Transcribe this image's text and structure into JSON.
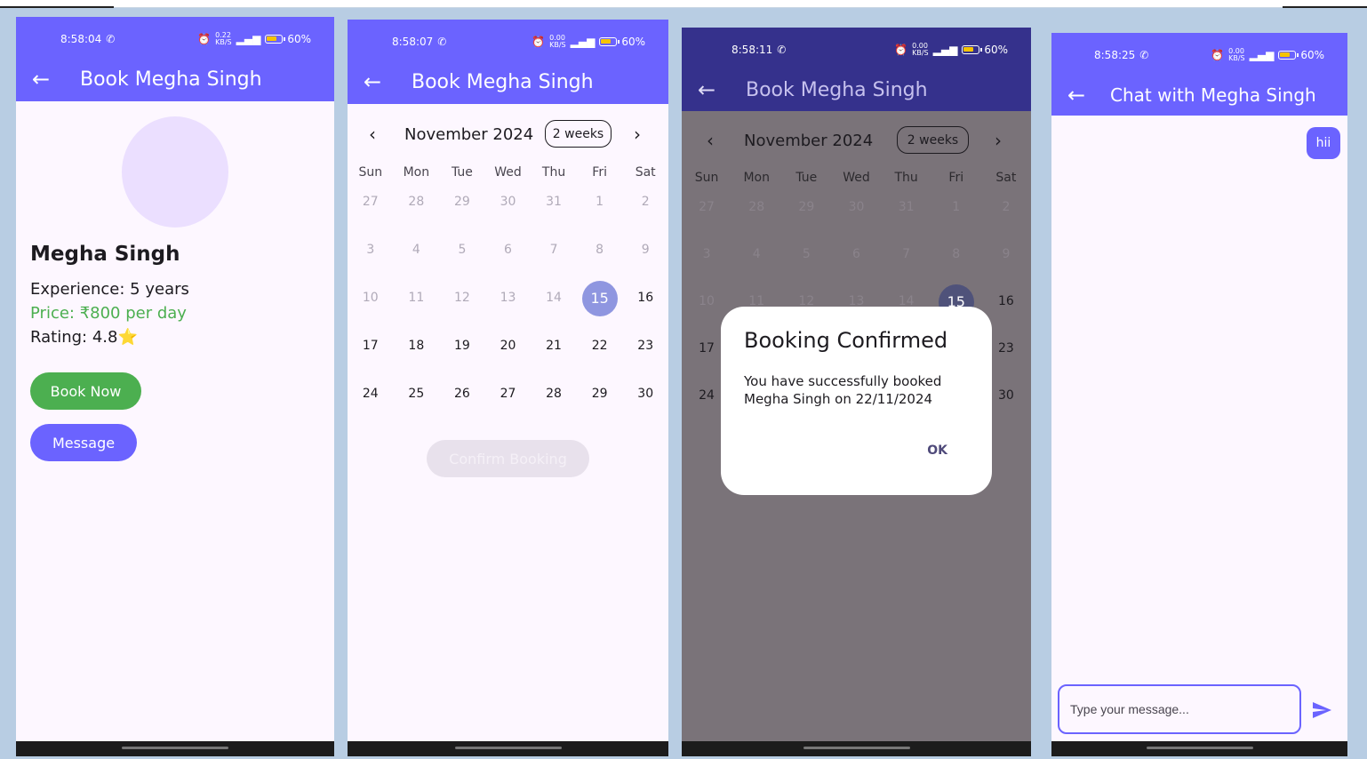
{
  "status": {
    "p1_time": "8:58:04",
    "p2_time": "8:58:07",
    "p3_time": "8:58:11",
    "p4_time": "8:58:25",
    "p1_speed": "0.22",
    "speed_other": "0.00",
    "speed_unit": "KB/S",
    "battery": "60%"
  },
  "colors": {
    "primary": "#6b63ff",
    "green": "#4caf50",
    "avatar": "#ebdfff"
  },
  "profile": {
    "title": "Book Megha Singh",
    "name": "Megha Singh",
    "experience": "Experience: 5 years",
    "price": "Price: ₹800 per day",
    "rating": "Rating: 4.8",
    "rating_star": "⭐",
    "book_now": "Book Now",
    "message": "Message"
  },
  "calendar": {
    "title": "Book Megha Singh",
    "month": "November 2024",
    "format": "2 weeks",
    "prev": "‹",
    "next": "›",
    "weekdays": [
      "Sun",
      "Mon",
      "Tue",
      "Wed",
      "Thu",
      "Fri",
      "Sat"
    ],
    "rows": [
      [
        "27",
        "28",
        "29",
        "30",
        "31",
        "1",
        "2"
      ],
      [
        "3",
        "4",
        "5",
        "6",
        "7",
        "8",
        "9"
      ],
      [
        "10",
        "11",
        "12",
        "13",
        "14",
        "15",
        "16"
      ],
      [
        "17",
        "18",
        "19",
        "20",
        "21",
        "22",
        "23"
      ],
      [
        "24",
        "25",
        "26",
        "27",
        "28",
        "29",
        "30"
      ]
    ],
    "selected": "15",
    "confirm": "Confirm Booking"
  },
  "dialog": {
    "title": "Booking Confirmed",
    "body": "You have successfully booked Megha Singh on 22/11/2024",
    "ok": "OK"
  },
  "chat": {
    "title": "Chat with Megha Singh",
    "messages": [
      "hii"
    ],
    "input_placeholder": "Type your message..."
  },
  "icons": {
    "back": "arrow-back-icon",
    "send": "send-icon",
    "whatsapp": "whatsapp-icon",
    "alarm": "alarm-icon",
    "signal": "signal-icon",
    "battery": "battery-icon"
  }
}
